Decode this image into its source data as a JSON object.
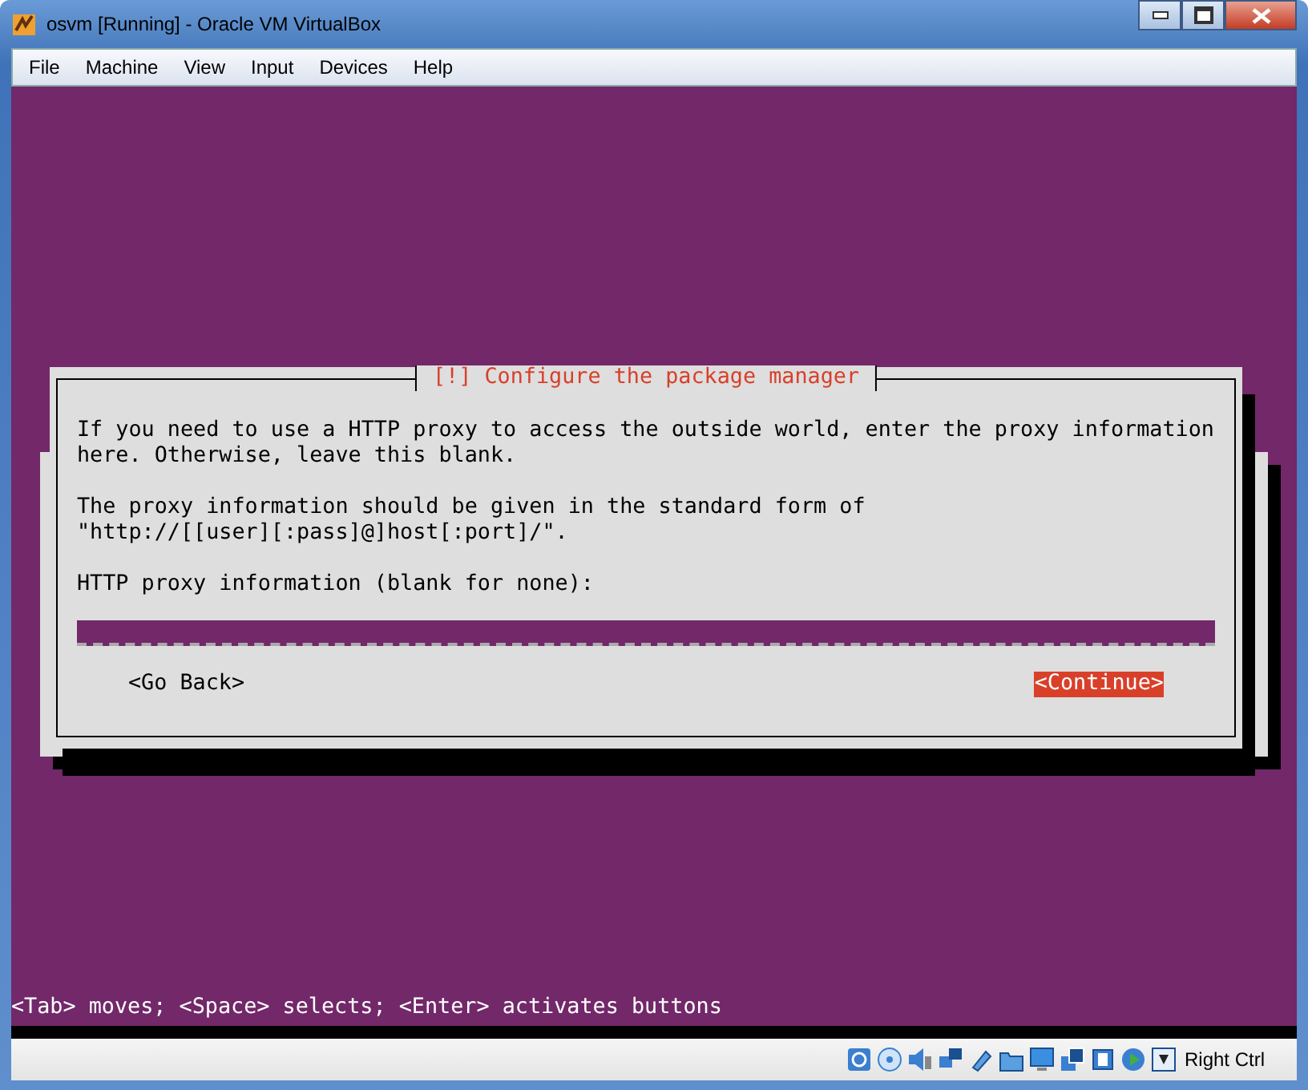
{
  "window": {
    "title": "osvm [Running] - Oracle VM VirtualBox"
  },
  "menu": [
    "File",
    "Machine",
    "View",
    "Input",
    "Devices",
    "Help"
  ],
  "dialog": {
    "title": "[!] Configure the package manager",
    "paragraphs": [
      "If you need to use a HTTP proxy to access the outside world, enter the proxy information\nhere. Otherwise, leave this blank.",
      "The proxy information should be given in the standard form of\n\"http://[[user][:pass]@]host[:port]/\"."
    ],
    "field_label": "HTTP proxy information (blank for none):",
    "buttons": [
      {
        "label": "<Go Back>",
        "selected": false
      },
      {
        "label": "<Continue>",
        "selected": true
      }
    ]
  },
  "hint": "<Tab> moves; <Space> selects; <Enter> activates buttons",
  "status_bar": {
    "host_key": "Right Ctrl"
  }
}
